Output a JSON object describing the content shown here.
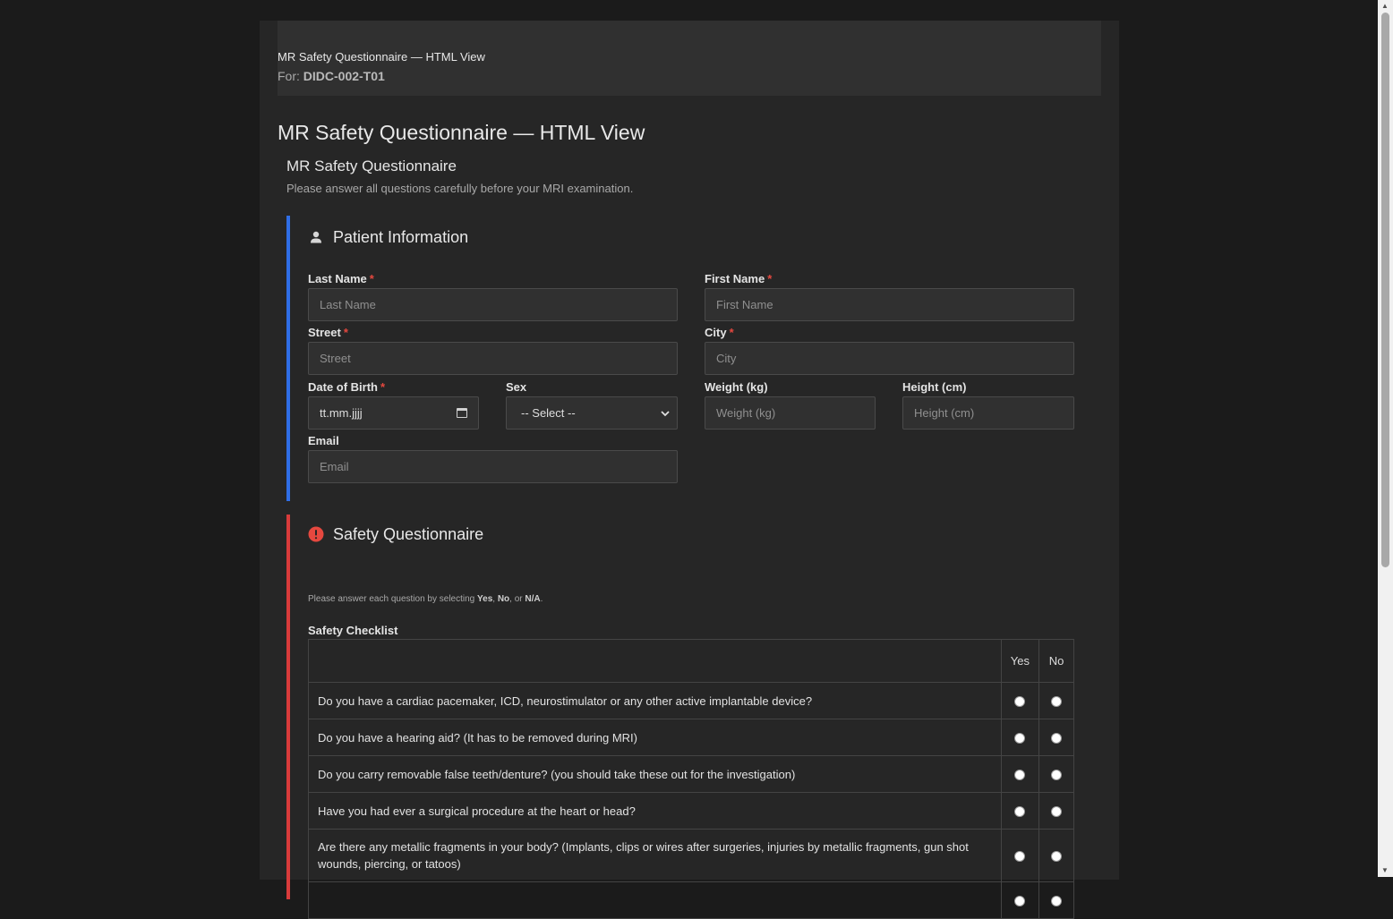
{
  "topbar": {
    "title": "MR Safety Questionnaire — HTML View",
    "for_label": "For:",
    "for_value": "DIDC-002-T01"
  },
  "page_title": "MR Safety Questionnaire — HTML View",
  "form_title": "MR Safety Questionnaire",
  "intro": "Please answer all questions carefully before your MRI examination.",
  "patient": {
    "heading": "Patient Information",
    "last_name": {
      "label": "Last Name",
      "placeholder": "Last Name"
    },
    "first_name": {
      "label": "First Name",
      "placeholder": "First Name"
    },
    "street": {
      "label": "Street",
      "placeholder": "Street"
    },
    "city": {
      "label": "City",
      "placeholder": "City"
    },
    "dob": {
      "label": "Date of Birth",
      "value": "tt.mm.jjjj"
    },
    "sex": {
      "label": "Sex",
      "value": "-- Select --"
    },
    "weight": {
      "label": "Weight (kg)",
      "placeholder": "Weight (kg)"
    },
    "height": {
      "label": "Height (cm)",
      "placeholder": "Height (cm)"
    },
    "email": {
      "label": "Email",
      "placeholder": "Email"
    },
    "required_mark": "*"
  },
  "safety": {
    "heading": "Safety Questionnaire",
    "note_prefix": "Please answer each question by selecting",
    "opt_yes": "Yes",
    "opt_no": "No",
    "opt_na": "N/A",
    "note_sep": ",",
    "note_or": "or",
    "note_end": ".",
    "checklist_title": "Safety Checklist",
    "col_yes": "Yes",
    "col_no": "No",
    "questions": [
      "Do you have a cardiac pacemaker, ICD, neurostimulator or any other active implantable device?",
      "Do you have a hearing aid? (It has to be removed during MRI)",
      "Do you carry removable false teeth/denture? (you should take these out for the investigation)",
      "Have you had ever a surgical procedure at the heart or head?",
      "Are there any metallic fragments in your body? (Implants, clips or wires after surgeries, injuries by metallic fragments, gun shot wounds, piercing, or tatoos)"
    ]
  }
}
